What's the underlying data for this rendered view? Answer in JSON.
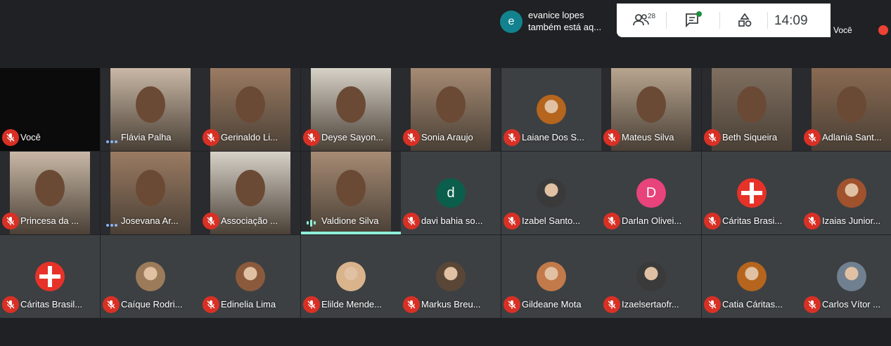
{
  "notification": {
    "avatar_letter": "e",
    "line1": "evanice lopes",
    "line2": "também está aq..."
  },
  "controls": {
    "participants_count": "28",
    "people_icon": "people-icon",
    "chat_icon": "chat-icon",
    "activities_icon": "activities-icon",
    "time": "14:09"
  },
  "self_preview": {
    "name": "Você"
  },
  "tiles": [
    {
      "name": "Você",
      "mic": "muted",
      "kind": "dark"
    },
    {
      "name": "Flávia Palha",
      "mic": "dots",
      "kind": "video"
    },
    {
      "name": "Gerinaldo Li...",
      "mic": "muted",
      "kind": "video"
    },
    {
      "name": "Deyse Sayon...",
      "mic": "muted",
      "kind": "video"
    },
    {
      "name": "Sonia Araujo",
      "mic": "muted",
      "kind": "video"
    },
    {
      "name": "Laiane Dos S...",
      "mic": "muted",
      "kind": "avatar"
    },
    {
      "name": "Mateus Silva",
      "mic": "muted",
      "kind": "video"
    },
    {
      "name": "Beth Siqueira",
      "mic": "muted",
      "kind": "video"
    },
    {
      "name": "Adlania Sant...",
      "mic": "muted",
      "kind": "video"
    },
    {
      "name": "Princesa da ...",
      "mic": "muted",
      "kind": "video"
    },
    {
      "name": "Josevana Ar...",
      "mic": "dots",
      "kind": "video"
    },
    {
      "name": "Associação ...",
      "mic": "muted",
      "kind": "video"
    },
    {
      "name": "Valdione Silva",
      "mic": "speaking",
      "kind": "video"
    },
    {
      "name": "davi bahia so...",
      "mic": "muted",
      "kind": "letter",
      "letter": "d",
      "color": "#0b5e4b"
    },
    {
      "name": "Izabel Santo...",
      "mic": "muted",
      "kind": "avatar"
    },
    {
      "name": "Darlan Olivei...",
      "mic": "muted",
      "kind": "letter",
      "letter": "D",
      "color": "#e8437b"
    },
    {
      "name": "Cáritas Brasi...",
      "mic": "muted",
      "kind": "caritas"
    },
    {
      "name": "Izaias Junior...",
      "mic": "muted",
      "kind": "avatar"
    },
    {
      "name": "Cáritas Brasil...",
      "mic": "muted",
      "kind": "caritas"
    },
    {
      "name": "Caíque Rodri...",
      "mic": "muted",
      "kind": "avatar"
    },
    {
      "name": "Edinelia Lima",
      "mic": "muted",
      "kind": "avatar"
    },
    {
      "name": "Elilde Mende...",
      "mic": "muted",
      "kind": "avatar"
    },
    {
      "name": "Markus Breu...",
      "mic": "muted",
      "kind": "avatar"
    },
    {
      "name": "Gildeane Mota",
      "mic": "muted",
      "kind": "avatar"
    },
    {
      "name": "Izaelsertaofr...",
      "mic": "muted",
      "kind": "avatar"
    },
    {
      "name": "Catia Cáritas...",
      "mic": "muted",
      "kind": "avatar"
    },
    {
      "name": "Carlos Vítor ...",
      "mic": "muted",
      "kind": "avatar"
    }
  ]
}
